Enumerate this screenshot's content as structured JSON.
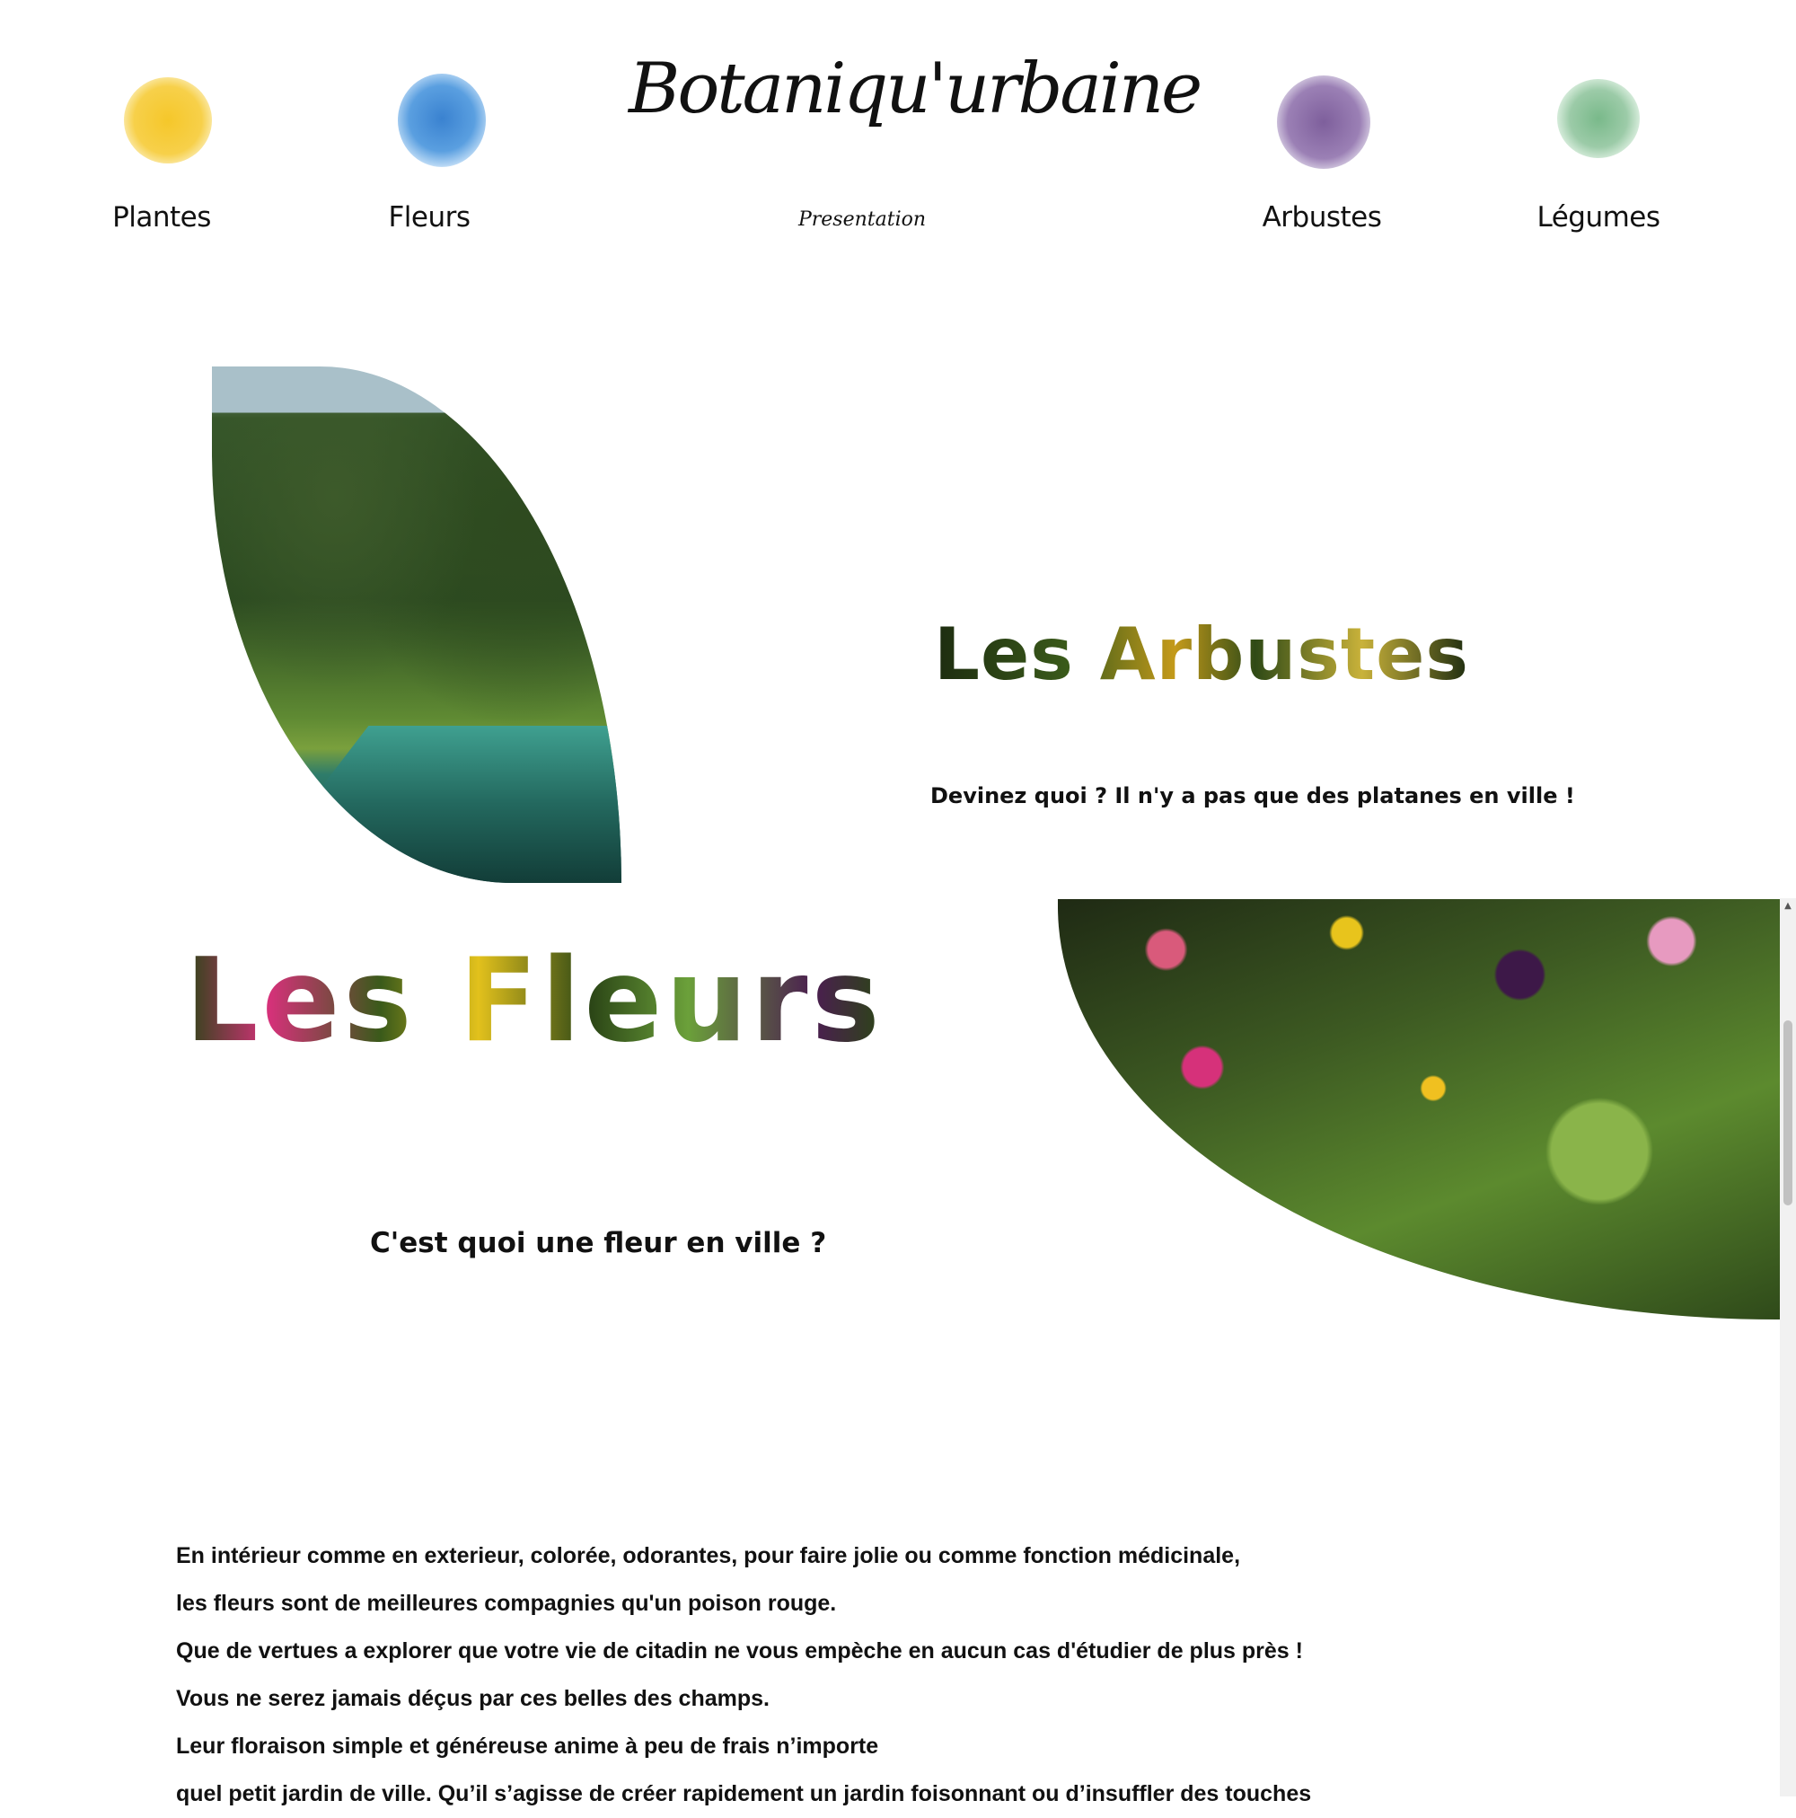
{
  "header": {
    "brand": "Botaniqu'urbaine",
    "subtitle": "Presentation",
    "nav": [
      {
        "label": "Plantes",
        "color": "#f2c72e"
      },
      {
        "label": "Fleurs",
        "color": "#4f95d8"
      },
      {
        "label": "Arbustes",
        "color": "#8e72a8"
      },
      {
        "label": "Légumes",
        "color": "#7fbf93"
      }
    ]
  },
  "arbustes": {
    "title": "Les Arbustes",
    "tagline": "Devinez quoi ? Il n'y a pas que des platanes en ville !"
  },
  "fleurs": {
    "title": "Les Fleurs",
    "tagline": "C'est quoi une fleur en ville ?",
    "paragraphs": [
      "En intérieur comme en exterieur, colorée, odorantes, pour faire jolie ou comme fonction médicinale,",
      "les fleurs sont de meilleures compagnies qu'un poison rouge.",
      "Que de vertues a explorer que votre vie de citadin ne vous empèche en aucun cas d'étudier de plus près !",
      "Vous ne serez jamais déçus par ces belles des champs.",
      "Leur floraison simple et généreuse anime à peu de frais n’importe",
      "quel petit jardin de ville. Qu’il s’agisse de créer rapidement un jardin foisonnant ou d’insuffler des touches"
    ]
  },
  "scrollbar": {
    "up_arrow": "▲"
  }
}
